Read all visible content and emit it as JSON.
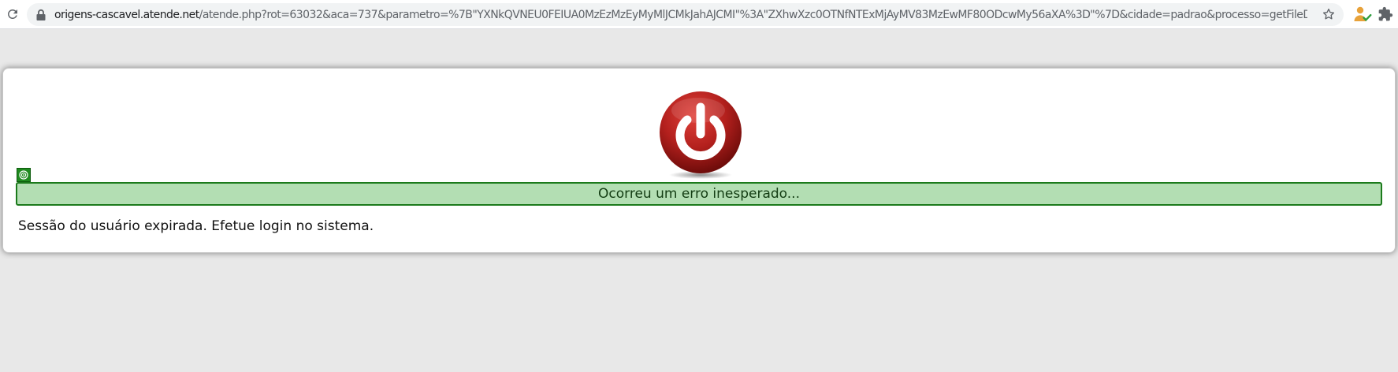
{
  "browser": {
    "url_host": "origens-cascavel.atende.net",
    "url_rest": "/atende.php?rot=63032&aca=737&parametro=%7B\"YXNkQVNEU0FEIUA0MzEzMzEyMyMlJCMkJahAJCMI\"%3A\"ZXhwXzc0OTNfNTExMjAyMV83MzEwMF80ODcwMy56aXA%3D\"%7D&cidade=padrao&processo=getFileDownload",
    "icons": {
      "reload": "reload-icon",
      "lock": "lock-icon",
      "bookmark": "star-icon",
      "profile": "profile-extension-icon",
      "extensions": "puzzle-icon"
    }
  },
  "page": {
    "logo_icon": "power-icon",
    "marker_icon": "target-icon",
    "error_title": "Ocorreu um erro inesperado...",
    "error_message": "Sessão do usuário expirada. Efetue login no sistema."
  },
  "colors": {
    "background": "#e8e8e8",
    "banner_fill": "#b3deb3",
    "banner_border": "#1c7a1c",
    "logo_red": "#b3201d"
  }
}
